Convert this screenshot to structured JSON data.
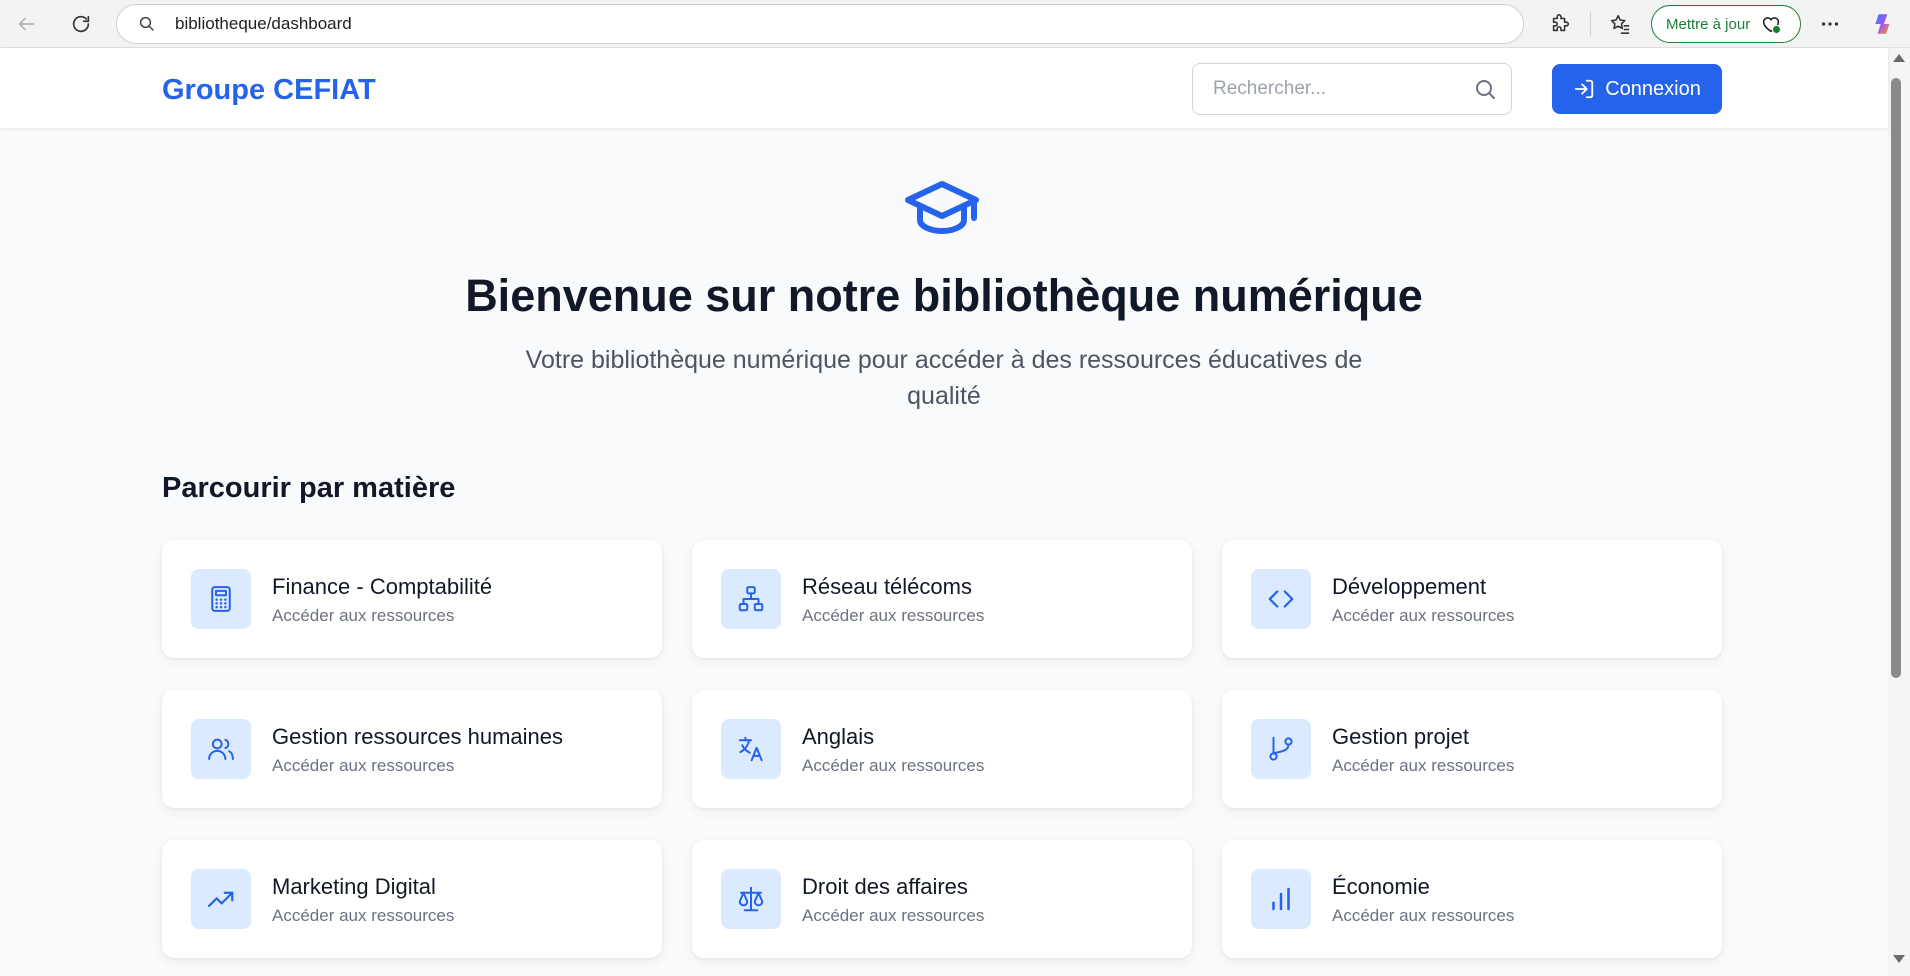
{
  "browser": {
    "url": "bibliotheque/dashboard",
    "update_label": "Mettre à jour"
  },
  "header": {
    "brand": "Groupe CEFIAT",
    "search_placeholder": "Rechercher...",
    "login_label": "Connexion"
  },
  "hero": {
    "title": "Bienvenue sur notre bibliothèque numérique",
    "subtitle": "Votre bibliothèque numérique pour accéder à des ressources éducatives de qualité"
  },
  "section_title": "Parcourir par matière",
  "subjects": [
    {
      "title": "Finance - Comptabilité",
      "subtitle": "Accéder aux ressources",
      "icon": "calculator-icon"
    },
    {
      "title": "Réseau télécoms",
      "subtitle": "Accéder aux ressources",
      "icon": "network-icon"
    },
    {
      "title": "Développement",
      "subtitle": "Accéder aux ressources",
      "icon": "code-icon"
    },
    {
      "title": "Gestion ressources humaines",
      "subtitle": "Accéder aux ressources",
      "icon": "users-icon"
    },
    {
      "title": "Anglais",
      "subtitle": "Accéder aux ressources",
      "icon": "languages-icon"
    },
    {
      "title": "Gestion projet",
      "subtitle": "Accéder aux ressources",
      "icon": "git-branch-icon"
    },
    {
      "title": "Marketing Digital",
      "subtitle": "Accéder aux ressources",
      "icon": "trending-up-icon"
    },
    {
      "title": "Droit des affaires",
      "subtitle": "Accéder aux ressources",
      "icon": "scale-icon"
    },
    {
      "title": "Économie",
      "subtitle": "Accéder aux ressources",
      "icon": "bar-chart-icon"
    }
  ],
  "colors": {
    "accent": "#2563eb",
    "icon_bg": "#dbeafe",
    "page_bg": "#f9fafb",
    "update_green": "#1a7f37"
  }
}
